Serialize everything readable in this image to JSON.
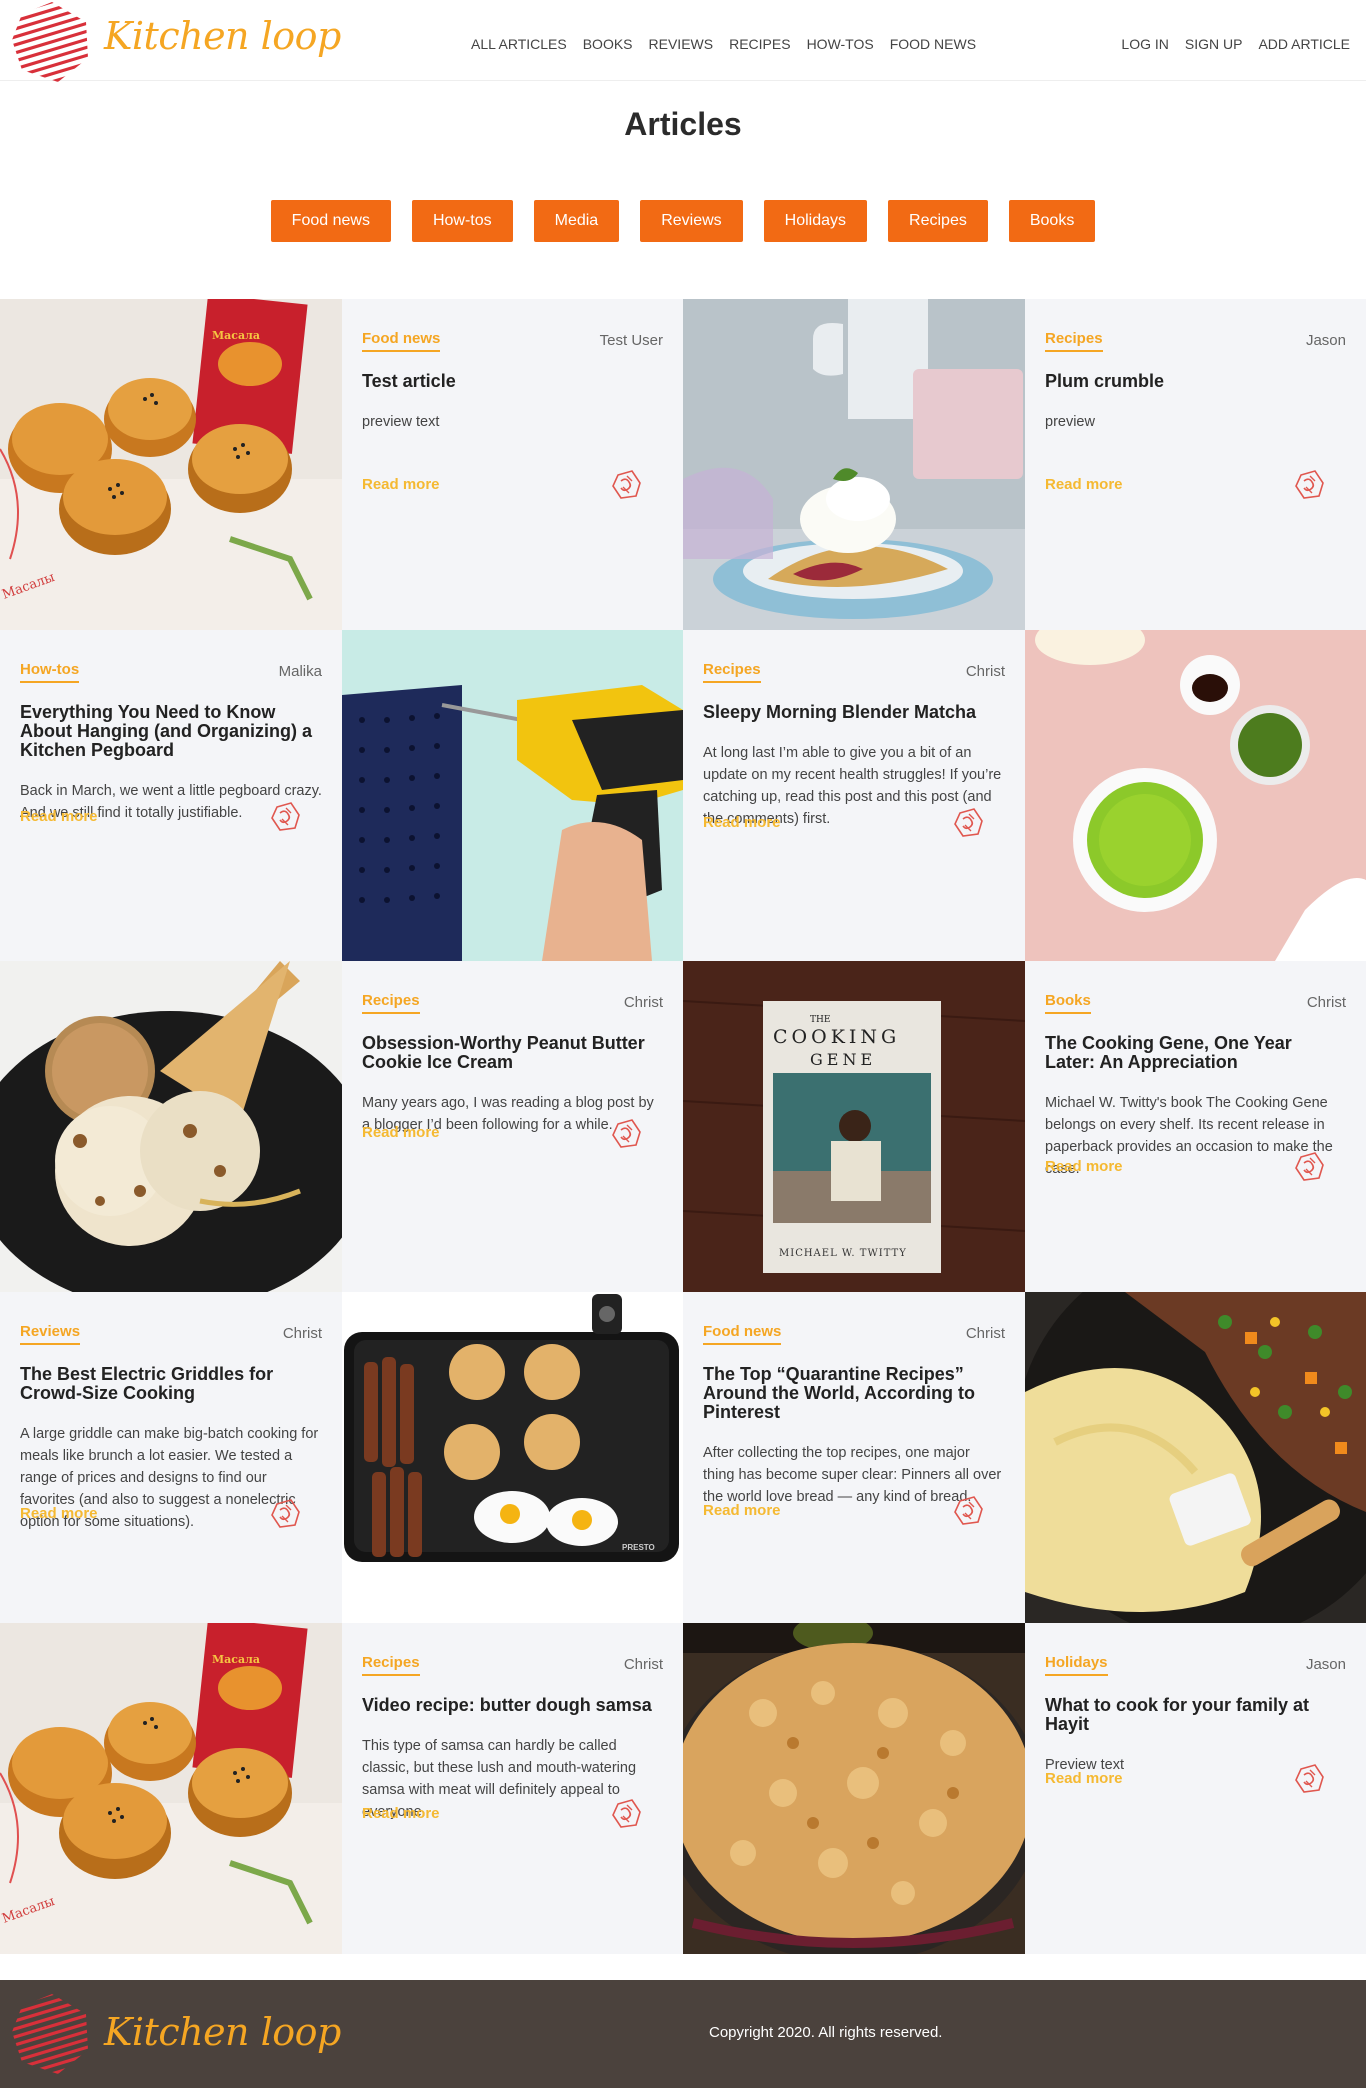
{
  "header": {
    "brand": "Kitchen loop",
    "nav": [
      "ALL ARTICLES",
      "BOOKS",
      "REVIEWS",
      "RECIPES",
      "HOW-TOS",
      "FOOD NEWS"
    ],
    "auth": [
      "LOG IN",
      "SIGN UP",
      "ADD ARTICLE"
    ]
  },
  "page": {
    "title": "Articles",
    "filters": [
      "Food news",
      "How-tos",
      "Media",
      "Reviews",
      "Holidays",
      "Recipes",
      "Books"
    ]
  },
  "read_more": "Read more",
  "articles": [
    {
      "category": "Food news",
      "author": "Test User",
      "title": "Test article",
      "preview": "preview text",
      "image": "buns"
    },
    {
      "category": "Recipes",
      "author": "Jason",
      "title": "Plum crumble",
      "preview": "preview",
      "image": "crumble-icecream"
    },
    {
      "category": "How-tos",
      "author": "Malika",
      "title": "Everything You Need to Know About Hanging (and Organizing) a Kitchen Pegboard",
      "preview": "Back in March, we went a little pegboard crazy. And we still find it totally justifiable.",
      "image": "drill-pegboard"
    },
    {
      "category": "Recipes",
      "author": "Christ",
      "title": "Sleepy Morning Blender Matcha",
      "preview": "At long last I’m able to give you a bit of an update on my recent health struggles! If you’re catching up, read this post and this post (and the comments) first.",
      "image": "matcha"
    },
    {
      "category": "Recipes",
      "author": "Christ",
      "title": "Obsession-Worthy Peanut Butter Cookie Ice Cream",
      "preview": "Many years ago, I was reading a blog post by a blogger I’d been following for a while.",
      "image": "ice-cream-cone"
    },
    {
      "category": "Books",
      "author": "Christ",
      "title": "The Cooking Gene, One Year Later: An Appreciation",
      "preview": "Michael W. Twitty's book The Cooking Gene belongs on every shelf. Its recent release in paperback provides an occasion to make the case.",
      "image": "cooking-gene-book"
    },
    {
      "category": "Reviews",
      "author": "Christ",
      "title": "The Best Electric Griddles for Crowd-Size Cooking",
      "preview": "A large griddle can make big-batch cooking for meals like brunch a lot easier. We tested a range of prices and designs to find our favorites (and also to suggest a nonelectric option for some situations).",
      "image": "griddle"
    },
    {
      "category": "Food news",
      "author": "Christ",
      "title": "The Top “Quarantine Recipes” Around the World, According to Pinterest",
      "preview": "After collecting the top recipes, one major thing has become super clear: Pinners all over the world love bread — any kind of bread.",
      "image": "shepherds-pie"
    },
    {
      "category": "Recipes",
      "author": "Christ",
      "title": "Video recipe: butter dough samsa",
      "preview": "This type of samsa can hardly be called classic, but these lush and mouth-watering samsa with meat will definitely appeal to everyone.",
      "image": "buns"
    },
    {
      "category": "Holidays",
      "author": "Jason",
      "title": "What to cook for your family at Hayit",
      "preview": "Preview text",
      "image": "crumble-pan"
    }
  ],
  "book_cover": {
    "top": "THE",
    "title1": "COOKING",
    "title2": "GENE",
    "author": "MICHAEL W. TWITTY"
  },
  "griddle_brand": "PRESTO",
  "bun_box": {
    "brand": "Масала",
    "word": "Масалы"
  },
  "footer": {
    "brand": "Kitchen loop",
    "copyright": "Copyright 2020. All rights reserved."
  },
  "colors": {
    "accent": "#f26a14",
    "category": "#f5a623",
    "footer_bg": "#4b423d",
    "card_bg": "#f4f5f8"
  }
}
